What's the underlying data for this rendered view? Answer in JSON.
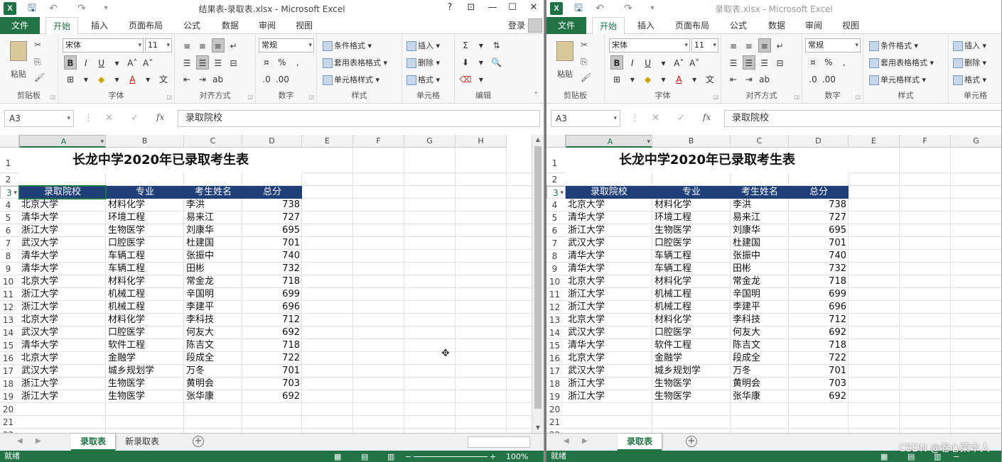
{
  "windows": [
    {
      "title": "结果表-录取表.xlsx - Microsoft Excel",
      "window_controls": [
        "?",
        "⊡",
        "—",
        "☐",
        "✕"
      ],
      "login": "登录",
      "menu": [
        "文件",
        "开始",
        "插入",
        "页面布局",
        "公式",
        "数据",
        "审阅",
        "视图"
      ],
      "font_name": "宋体",
      "font_size": "11",
      "number_format": "常规",
      "name_box": "A3",
      "formula": "录取院校",
      "sheet_tabs": [
        "录取表",
        "新录取表"
      ],
      "zoom": "100%"
    },
    {
      "title": "录取表.xlsx - Microsoft Excel",
      "menu": [
        "文件",
        "开始",
        "插入",
        "页面布局",
        "公式",
        "数据",
        "审阅",
        "视图"
      ],
      "font_name": "宋体",
      "font_size": "11",
      "number_format": "常规",
      "name_box": "A3",
      "formula": "录取院校",
      "sheet_tabs": [
        "录取表"
      ]
    }
  ],
  "ribbon_groups": {
    "clipboard": "剪贴板",
    "font": "字体",
    "alignment": "对齐方式",
    "number": "数字",
    "styles": "样式",
    "cells": "单元格",
    "editing": "编辑"
  },
  "ribbon_buttons": {
    "paste": "粘贴",
    "conditional_format": "条件格式",
    "table_format": "套用表格格式",
    "cell_style": "单元格样式",
    "insert": "插入",
    "delete": "删除",
    "format": "格式"
  },
  "columns_left": [
    "A",
    "B",
    "C",
    "D",
    "E",
    "F",
    "G",
    "H"
  ],
  "columns_right": [
    "A",
    "B",
    "C",
    "D",
    "E",
    "F",
    "G"
  ],
  "sheet": {
    "title": "长龙中学2020年已录取考生表",
    "headers": [
      "录取院校",
      "专业",
      "考生姓名",
      "总分"
    ],
    "rows": [
      [
        "北京大学",
        "材料化学",
        "李洪",
        "738"
      ],
      [
        "清华大学",
        "环境工程",
        "易来江",
        "727"
      ],
      [
        "浙江大学",
        "生物医学",
        "刘康华",
        "695"
      ],
      [
        "武汉大学",
        "口腔医学",
        "杜建国",
        "701"
      ],
      [
        "清华大学",
        "车辆工程",
        "张振中",
        "740"
      ],
      [
        "清华大学",
        "车辆工程",
        "田彬",
        "732"
      ],
      [
        "北京大学",
        "材料化学",
        "常金龙",
        "718"
      ],
      [
        "浙江大学",
        "机械工程",
        "辛国明",
        "699"
      ],
      [
        "浙江大学",
        "机械工程",
        "李建平",
        "696"
      ],
      [
        "北京大学",
        "材料化学",
        "李科技",
        "712"
      ],
      [
        "武汉大学",
        "口腔医学",
        "何友大",
        "692"
      ],
      [
        "清华大学",
        "软件工程",
        "陈吉文",
        "718"
      ],
      [
        "北京大学",
        "金融学",
        "段成全",
        "722"
      ],
      [
        "武汉大学",
        "城乡规划学",
        "万冬",
        "701"
      ],
      [
        "浙江大学",
        "生物医学",
        "黄明会",
        "703"
      ],
      [
        "浙江大学",
        "生物医学",
        "张华康",
        "692"
      ]
    ]
  },
  "status": "就绪",
  "watermark": "CSDN @卷心菜本人",
  "colors": {
    "excel_green": "#217346",
    "header_fill": "#1f3f78"
  }
}
